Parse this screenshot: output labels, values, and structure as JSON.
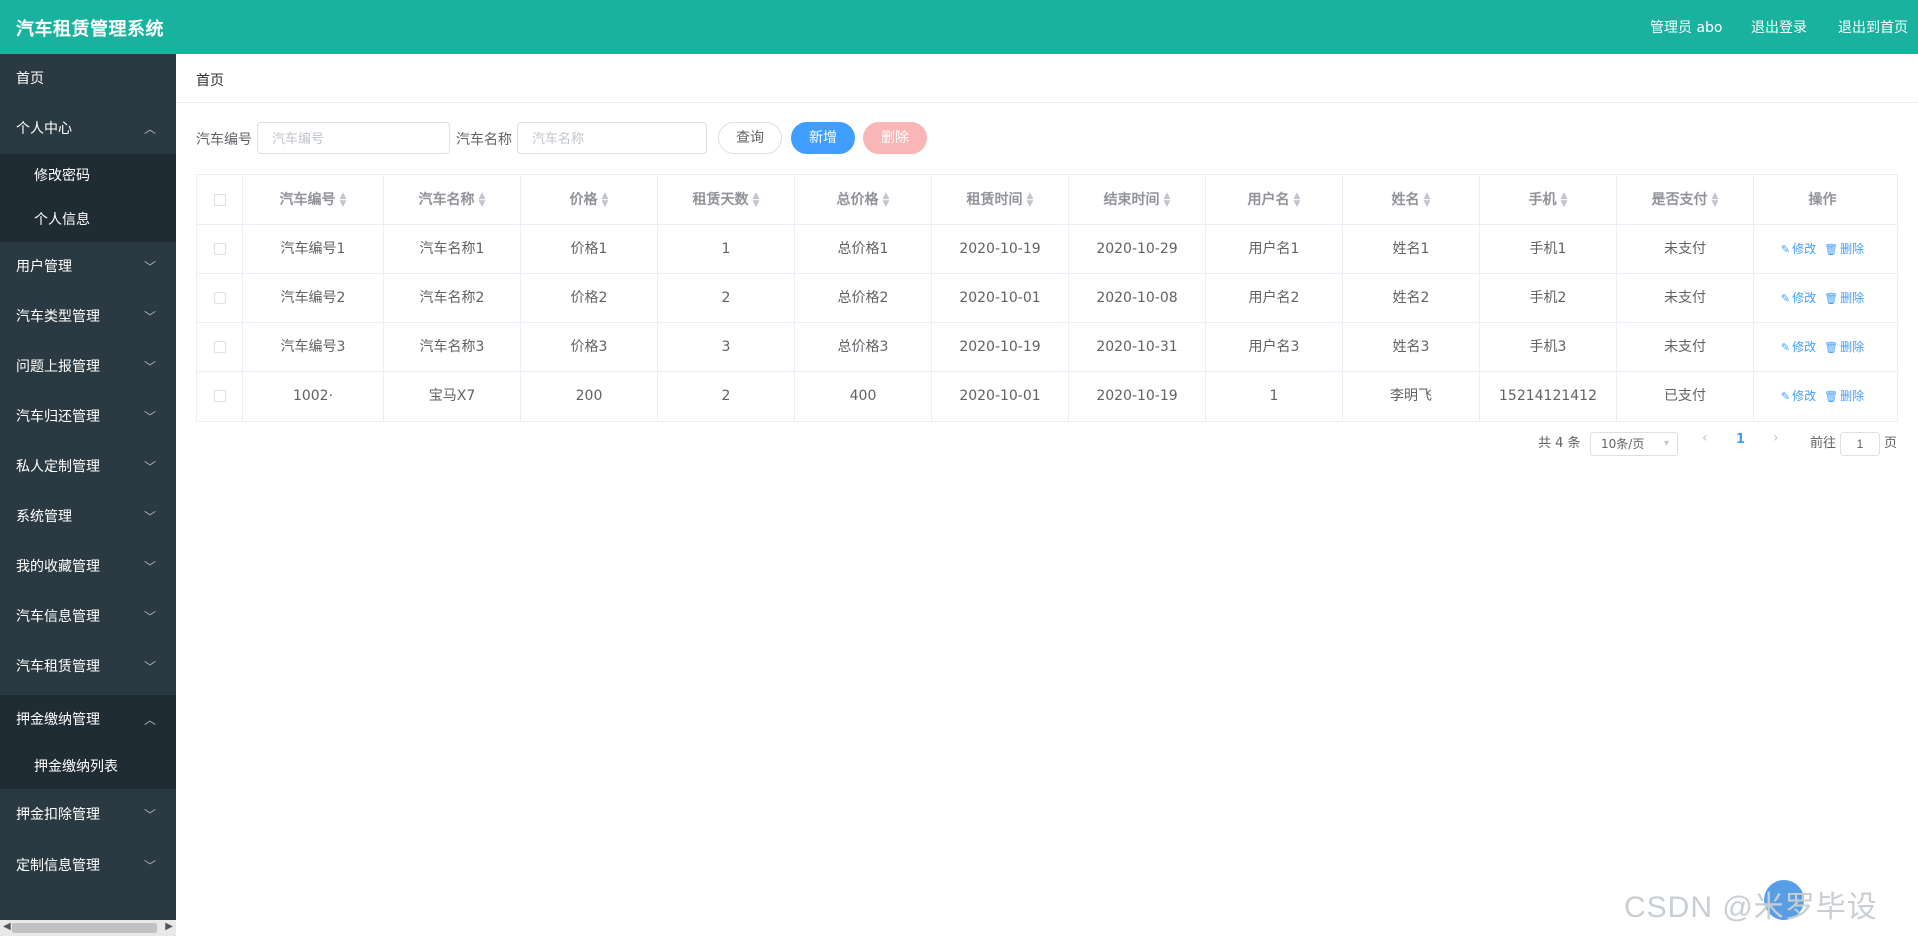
{
  "header": {
    "title": "汽车租赁管理系统",
    "admin_label": "管理员 abo",
    "logout_label": "退出登录",
    "home_label": "退出到首页"
  },
  "sidebar": {
    "home": "首页",
    "groups": [
      {
        "label": "个人中心",
        "expanded": true,
        "children": [
          "修改密码",
          "个人信息"
        ]
      },
      {
        "label": "用户管理",
        "expanded": false
      },
      {
        "label": "汽车类型管理",
        "expanded": false
      },
      {
        "label": "问题上报管理",
        "expanded": false
      },
      {
        "label": "汽车归还管理",
        "expanded": false
      },
      {
        "label": "私人定制管理",
        "expanded": false
      },
      {
        "label": "系统管理",
        "expanded": false
      },
      {
        "label": "我的收藏管理",
        "expanded": false
      },
      {
        "label": "汽车信息管理",
        "expanded": false
      },
      {
        "label": "汽车租赁管理",
        "expanded": false
      },
      {
        "label": "押金缴纳管理",
        "expanded": true,
        "children": [
          "押金缴纳列表"
        ]
      },
      {
        "label": "押金扣除管理",
        "expanded": false
      },
      {
        "label": "定制信息管理",
        "expanded": false
      }
    ]
  },
  "main": {
    "breadcrumb": "首页",
    "search": {
      "car_no_label": "汽车编号",
      "car_no_placeholder": "汽车编号",
      "car_name_label": "汽车名称",
      "car_name_placeholder": "汽车名称",
      "query_button": "查询",
      "add_button": "新增",
      "delete_button": "删除"
    },
    "table": {
      "columns": [
        "汽车编号",
        "汽车名称",
        "价格",
        "租赁天数",
        "总价格",
        "租赁时间",
        "结束时间",
        "用户名",
        "姓名",
        "手机",
        "是否支付",
        "操作"
      ],
      "rows": [
        [
          "汽车编号1",
          "汽车名称1",
          "价格1",
          "1",
          "总价格1",
          "2020-10-19",
          "2020-10-29",
          "用户名1",
          "姓名1",
          "手机1",
          "未支付"
        ],
        [
          "汽车编号2",
          "汽车名称2",
          "价格2",
          "2",
          "总价格2",
          "2020-10-01",
          "2020-10-08",
          "用户名2",
          "姓名2",
          "手机2",
          "未支付"
        ],
        [
          "汽车编号3",
          "汽车名称3",
          "价格3",
          "3",
          "总价格3",
          "2020-10-19",
          "2020-10-31",
          "用户名3",
          "姓名3",
          "手机3",
          "未支付"
        ],
        [
          "1002·",
          "宝马X7",
          "200",
          "2",
          "400",
          "2020-10-01",
          "2020-10-19",
          "1",
          "李明飞",
          "15214121412",
          "已支付"
        ]
      ],
      "edit_label": "修改",
      "delete_label": "删除"
    },
    "pagination": {
      "total_text": "共 4 条",
      "page_size": "10条/页",
      "current_page": "1",
      "goto_prefix": "前往",
      "goto_value": "1",
      "goto_suffix": "页"
    }
  },
  "watermark": "CSDN @米罗毕设",
  "colors": {
    "header_bg": "#19b29f",
    "sidebar_bg": "#2b3a42",
    "primary": "#409eff",
    "danger_disabled": "#fab6b6"
  }
}
